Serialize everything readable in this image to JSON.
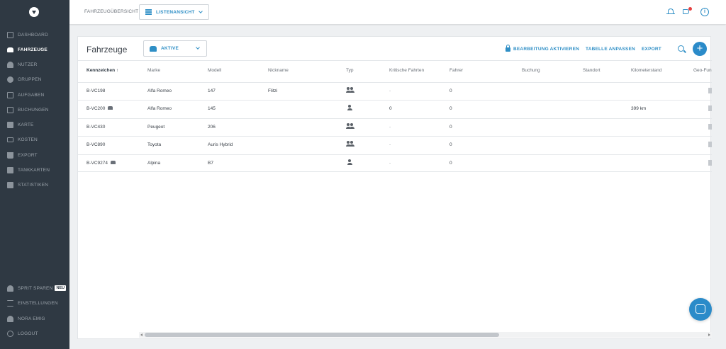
{
  "sidebar": {
    "items": [
      {
        "label": "DASHBOARD",
        "icon": "dashboard-icon",
        "active": false
      },
      {
        "label": "FAHRZEUGE",
        "icon": "car-icon",
        "active": true
      },
      {
        "label": "NUTZER",
        "icon": "user-icon",
        "active": false
      },
      {
        "label": "GRUPPEN",
        "icon": "group-icon",
        "active": false
      },
      {
        "label": "AUFGABEN",
        "icon": "tasks-icon",
        "active": false
      },
      {
        "label": "BUCHUNGEN",
        "icon": "calendar-icon",
        "active": false
      },
      {
        "label": "KARTE",
        "icon": "map-icon",
        "active": false
      },
      {
        "label": "KOSTEN",
        "icon": "card-icon",
        "active": false
      },
      {
        "label": "EXPORT",
        "icon": "download-icon",
        "active": false
      },
      {
        "label": "TANKKARTEN",
        "icon": "fuel-card-icon",
        "active": false
      },
      {
        "label": "STATISTIKEN",
        "icon": "chart-icon",
        "active": false
      }
    ],
    "bottom": [
      {
        "label": "SPRIT SPAREN",
        "icon": "user-icon",
        "badge": "NEU"
      },
      {
        "label": "EINSTELLUNGEN",
        "icon": "sliders-icon"
      },
      {
        "label": "NORA EMIG",
        "icon": "user-icon"
      },
      {
        "label": "LOGOUT",
        "icon": "power-icon"
      }
    ]
  },
  "topbar": {
    "breadcrumb": "FAHRZEUGÜBERSICHT",
    "view_select": "LISTENANSICHT"
  },
  "card": {
    "title": "Fahrzeuge",
    "filter": "AKTIVE",
    "actions": {
      "edit": "BEARBEITUNG AKTIVIEREN",
      "customize": "TABELLE ANPASSEN",
      "export": "EXPORT"
    }
  },
  "table": {
    "columns": [
      "Kennzeichen ↑",
      "Marke",
      "Modell",
      "Nickname",
      "Typ",
      "Kritische Fahrten",
      "Fahrer",
      "Buchung",
      "Standort",
      "Kilometerstand",
      "Geo-Fun"
    ],
    "rows": [
      {
        "plate": "B-VC198",
        "car": false,
        "brand": "Alfa Romeo",
        "model": "147",
        "nickname": "Flitzi",
        "type": "group",
        "critical": "-",
        "driver": "0",
        "booking": "",
        "location": "",
        "mileage": ""
      },
      {
        "plate": "B-VC200",
        "car": true,
        "brand": "Alfa Romeo",
        "model": "145",
        "nickname": "",
        "type": "single",
        "critical": "0",
        "driver": "0",
        "booking": "",
        "location": "",
        "mileage": "399 km"
      },
      {
        "plate": "B-VC430",
        "car": false,
        "brand": "Peugeot",
        "model": "206",
        "nickname": "",
        "type": "group",
        "critical": "-",
        "driver": "0",
        "booking": "",
        "location": "",
        "mileage": ""
      },
      {
        "plate": "B-VC890",
        "car": false,
        "brand": "Toyota",
        "model": "Auris Hybrid",
        "nickname": "",
        "type": "group",
        "critical": "-",
        "driver": "0",
        "booking": "",
        "location": "",
        "mileage": ""
      },
      {
        "plate": "B-VC9274",
        "car": true,
        "brand": "Alpina",
        "model": "B7",
        "nickname": "",
        "type": "single",
        "critical": "-",
        "driver": "0",
        "booking": "",
        "location": "",
        "mileage": ""
      }
    ]
  },
  "colors": {
    "sidebar": "#2f3943",
    "accent": "#2f8fc6",
    "fab": "#2b8bc9",
    "notification": "#e64040"
  }
}
